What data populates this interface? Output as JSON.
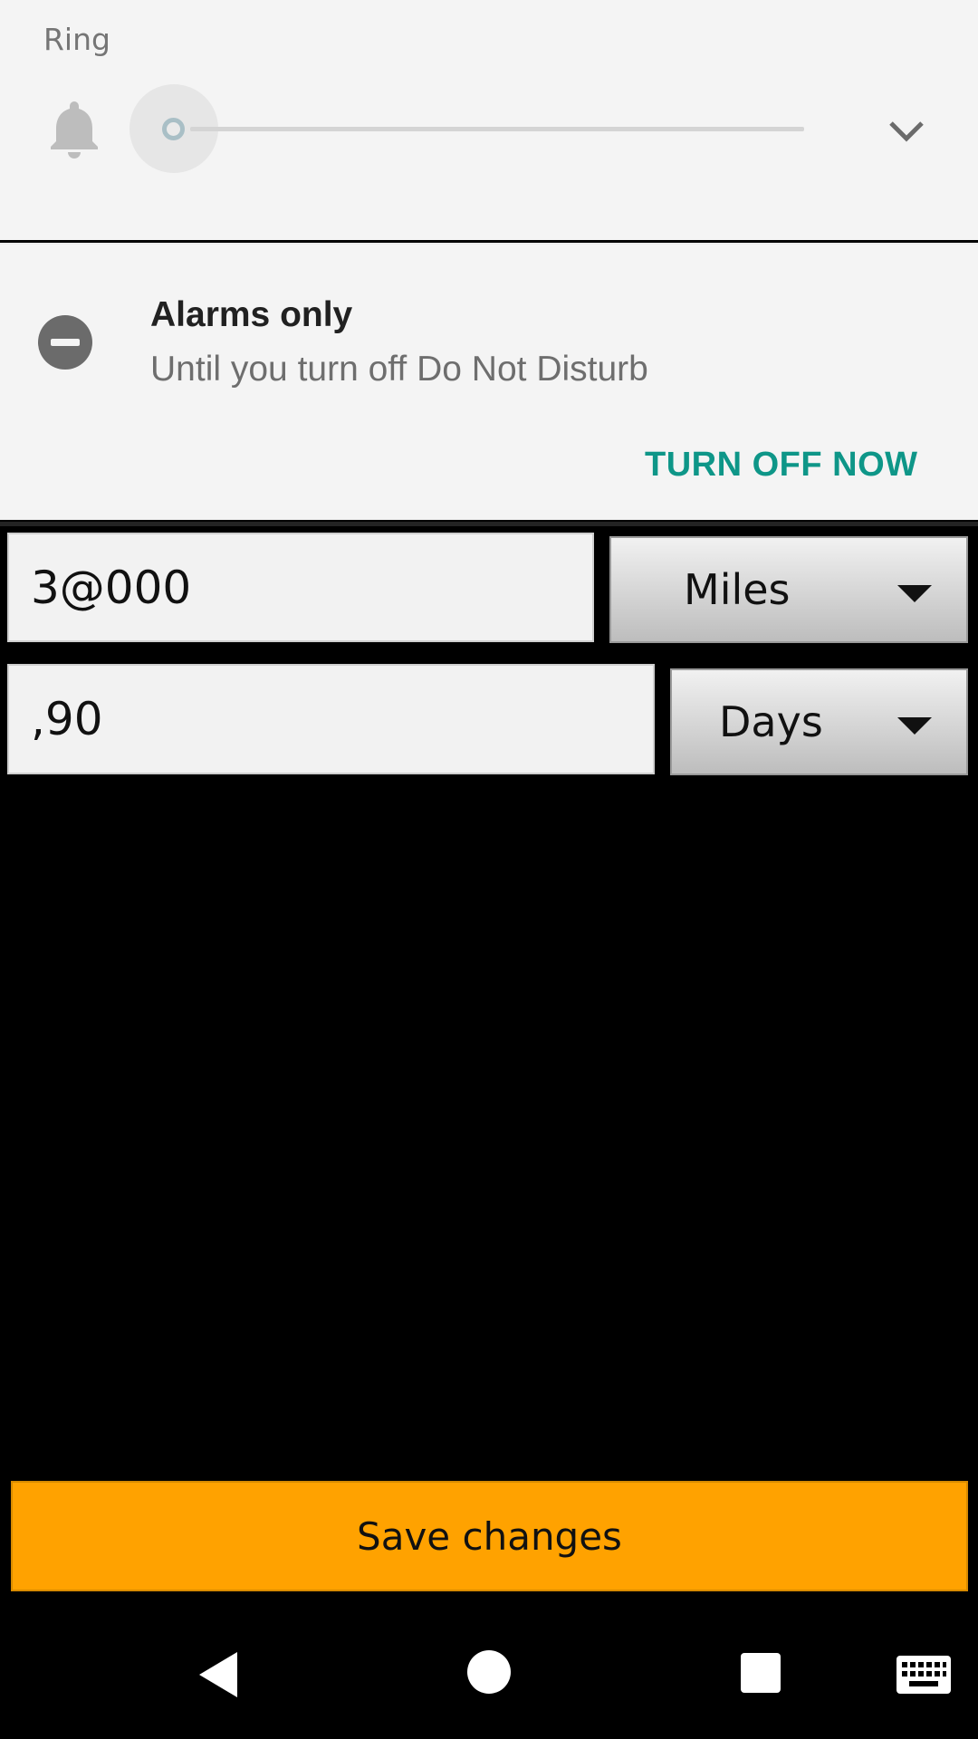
{
  "volume": {
    "label": "Ring",
    "level": 0,
    "icons": {
      "stream": "bell-icon",
      "expand": "chevron-down-icon"
    }
  },
  "dnd": {
    "icon": "do-not-disturb-icon",
    "title": "Alarms only",
    "subtitle": "Until you turn off Do Not Disturb",
    "action": "TURN OFF NOW"
  },
  "form": {
    "distance_value": "3@000",
    "distance_unit": "Miles",
    "time_value": ",90",
    "time_unit": "Days",
    "save_label": "Save changes"
  },
  "colors": {
    "accent": "#0e9688",
    "save_button": "#ffa200"
  },
  "navbar": {
    "icons": [
      "back-icon",
      "home-icon",
      "recents-icon",
      "keyboard-icon"
    ]
  }
}
